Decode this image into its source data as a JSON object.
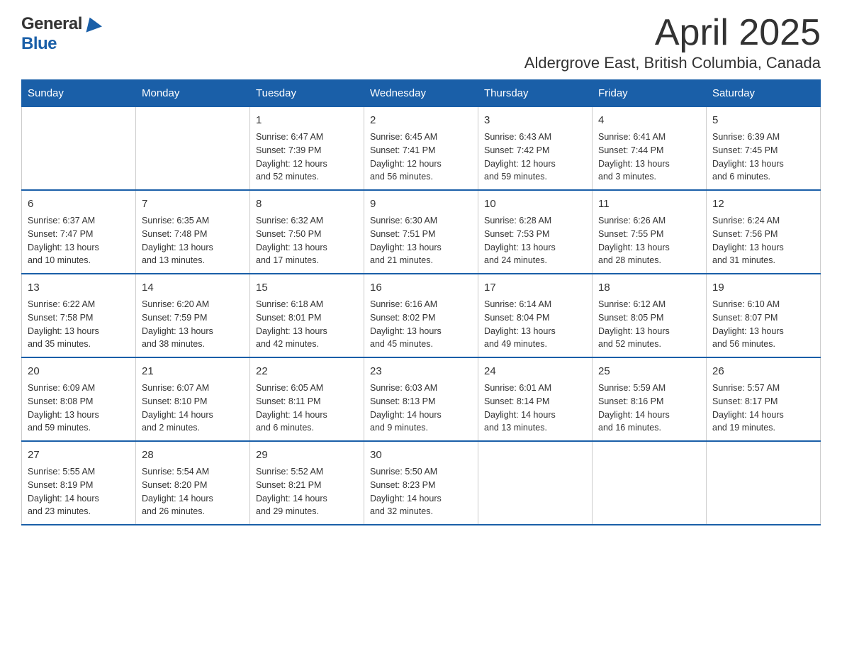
{
  "header": {
    "title": "April 2025",
    "subtitle": "Aldergrove East, British Columbia, Canada"
  },
  "logo": {
    "part1": "General",
    "part2": "Blue"
  },
  "calendar": {
    "days_of_week": [
      "Sunday",
      "Monday",
      "Tuesday",
      "Wednesday",
      "Thursday",
      "Friday",
      "Saturday"
    ],
    "weeks": [
      [
        {
          "day": "",
          "info": ""
        },
        {
          "day": "",
          "info": ""
        },
        {
          "day": "1",
          "info": "Sunrise: 6:47 AM\nSunset: 7:39 PM\nDaylight: 12 hours\nand 52 minutes."
        },
        {
          "day": "2",
          "info": "Sunrise: 6:45 AM\nSunset: 7:41 PM\nDaylight: 12 hours\nand 56 minutes."
        },
        {
          "day": "3",
          "info": "Sunrise: 6:43 AM\nSunset: 7:42 PM\nDaylight: 12 hours\nand 59 minutes."
        },
        {
          "day": "4",
          "info": "Sunrise: 6:41 AM\nSunset: 7:44 PM\nDaylight: 13 hours\nand 3 minutes."
        },
        {
          "day": "5",
          "info": "Sunrise: 6:39 AM\nSunset: 7:45 PM\nDaylight: 13 hours\nand 6 minutes."
        }
      ],
      [
        {
          "day": "6",
          "info": "Sunrise: 6:37 AM\nSunset: 7:47 PM\nDaylight: 13 hours\nand 10 minutes."
        },
        {
          "day": "7",
          "info": "Sunrise: 6:35 AM\nSunset: 7:48 PM\nDaylight: 13 hours\nand 13 minutes."
        },
        {
          "day": "8",
          "info": "Sunrise: 6:32 AM\nSunset: 7:50 PM\nDaylight: 13 hours\nand 17 minutes."
        },
        {
          "day": "9",
          "info": "Sunrise: 6:30 AM\nSunset: 7:51 PM\nDaylight: 13 hours\nand 21 minutes."
        },
        {
          "day": "10",
          "info": "Sunrise: 6:28 AM\nSunset: 7:53 PM\nDaylight: 13 hours\nand 24 minutes."
        },
        {
          "day": "11",
          "info": "Sunrise: 6:26 AM\nSunset: 7:55 PM\nDaylight: 13 hours\nand 28 minutes."
        },
        {
          "day": "12",
          "info": "Sunrise: 6:24 AM\nSunset: 7:56 PM\nDaylight: 13 hours\nand 31 minutes."
        }
      ],
      [
        {
          "day": "13",
          "info": "Sunrise: 6:22 AM\nSunset: 7:58 PM\nDaylight: 13 hours\nand 35 minutes."
        },
        {
          "day": "14",
          "info": "Sunrise: 6:20 AM\nSunset: 7:59 PM\nDaylight: 13 hours\nand 38 minutes."
        },
        {
          "day": "15",
          "info": "Sunrise: 6:18 AM\nSunset: 8:01 PM\nDaylight: 13 hours\nand 42 minutes."
        },
        {
          "day": "16",
          "info": "Sunrise: 6:16 AM\nSunset: 8:02 PM\nDaylight: 13 hours\nand 45 minutes."
        },
        {
          "day": "17",
          "info": "Sunrise: 6:14 AM\nSunset: 8:04 PM\nDaylight: 13 hours\nand 49 minutes."
        },
        {
          "day": "18",
          "info": "Sunrise: 6:12 AM\nSunset: 8:05 PM\nDaylight: 13 hours\nand 52 minutes."
        },
        {
          "day": "19",
          "info": "Sunrise: 6:10 AM\nSunset: 8:07 PM\nDaylight: 13 hours\nand 56 minutes."
        }
      ],
      [
        {
          "day": "20",
          "info": "Sunrise: 6:09 AM\nSunset: 8:08 PM\nDaylight: 13 hours\nand 59 minutes."
        },
        {
          "day": "21",
          "info": "Sunrise: 6:07 AM\nSunset: 8:10 PM\nDaylight: 14 hours\nand 2 minutes."
        },
        {
          "day": "22",
          "info": "Sunrise: 6:05 AM\nSunset: 8:11 PM\nDaylight: 14 hours\nand 6 minutes."
        },
        {
          "day": "23",
          "info": "Sunrise: 6:03 AM\nSunset: 8:13 PM\nDaylight: 14 hours\nand 9 minutes."
        },
        {
          "day": "24",
          "info": "Sunrise: 6:01 AM\nSunset: 8:14 PM\nDaylight: 14 hours\nand 13 minutes."
        },
        {
          "day": "25",
          "info": "Sunrise: 5:59 AM\nSunset: 8:16 PM\nDaylight: 14 hours\nand 16 minutes."
        },
        {
          "day": "26",
          "info": "Sunrise: 5:57 AM\nSunset: 8:17 PM\nDaylight: 14 hours\nand 19 minutes."
        }
      ],
      [
        {
          "day": "27",
          "info": "Sunrise: 5:55 AM\nSunset: 8:19 PM\nDaylight: 14 hours\nand 23 minutes."
        },
        {
          "day": "28",
          "info": "Sunrise: 5:54 AM\nSunset: 8:20 PM\nDaylight: 14 hours\nand 26 minutes."
        },
        {
          "day": "29",
          "info": "Sunrise: 5:52 AM\nSunset: 8:21 PM\nDaylight: 14 hours\nand 29 minutes."
        },
        {
          "day": "30",
          "info": "Sunrise: 5:50 AM\nSunset: 8:23 PM\nDaylight: 14 hours\nand 32 minutes."
        },
        {
          "day": "",
          "info": ""
        },
        {
          "day": "",
          "info": ""
        },
        {
          "day": "",
          "info": ""
        }
      ]
    ]
  }
}
